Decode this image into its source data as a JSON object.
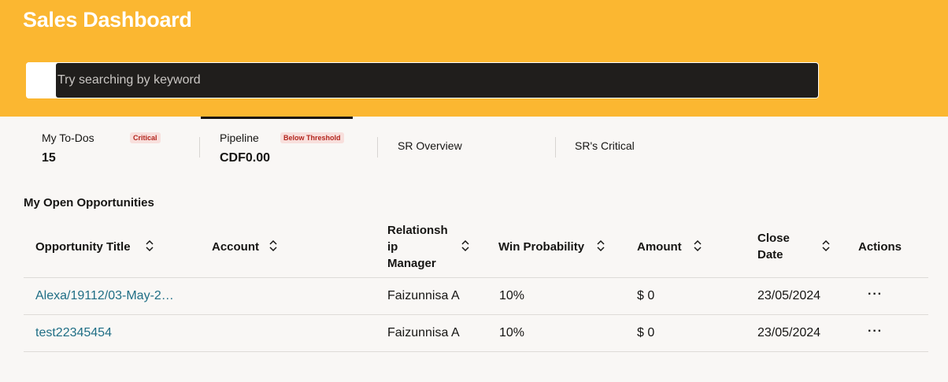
{
  "app": {
    "title": "Sales Dashboard"
  },
  "search": {
    "placeholder": "Try searching by keyword",
    "value": ""
  },
  "tabs": [
    {
      "label": "My To-Dos",
      "badge": "Critical",
      "value": "15"
    },
    {
      "label": "Pipeline",
      "badge": "Below Threshold",
      "value": "CDF0.00",
      "active": true
    },
    {
      "label": "SR Overview"
    },
    {
      "label": "SR's Critical"
    }
  ],
  "opportunities": {
    "title": "My Open Opportunities",
    "columns": {
      "title": "Opportunity Title",
      "account": "Account",
      "manager_l1": "Relationsh",
      "manager_l2": "ip",
      "manager_l3": "Manager",
      "win": "Win Probability",
      "amount": "Amount",
      "close_l1": "Close",
      "close_l2": "Date",
      "actions": "Actions"
    },
    "rows": [
      {
        "title": "Alexa/19112/03-May-2…",
        "account": "",
        "manager": "Faizunnisa A",
        "win": "10%",
        "amount": "$ 0",
        "close_date": "23/05/2024",
        "actions": "···"
      },
      {
        "title": "test22345454",
        "account": "",
        "manager": "Faizunnisa A",
        "win": "10%",
        "amount": "$ 0",
        "close_date": "23/05/2024",
        "actions": "···"
      }
    ]
  },
  "colors": {
    "header": "#fbb731",
    "search_bg": "#201e1c",
    "link": "#1f6e85",
    "badge_text": "#b3261e",
    "badge_bg": "#f8dfdc"
  },
  "icons": {
    "sort": "sort-up-down-icon",
    "actions": "more-horizontal-icon"
  }
}
